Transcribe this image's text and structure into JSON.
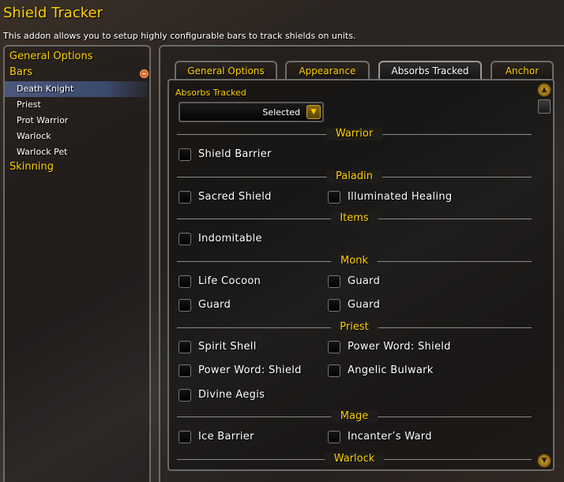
{
  "header": {
    "title": "Shield Tracker",
    "description": "This addon allows you to setup highly configurable bars to track shields on units."
  },
  "tree": {
    "general_options": "General Options",
    "bars": "Bars",
    "bar_items": [
      "Death Knight",
      "Priest",
      "Prot Warrior",
      "Warlock",
      "Warlock Pet"
    ],
    "selected": "Death Knight",
    "skinning": "Skinning"
  },
  "tabs": [
    "General Options",
    "Appearance",
    "Absorbs Tracked",
    "Anchor"
  ],
  "active_tab": "Absorbs Tracked",
  "absorbs": {
    "group_label": "Absorbs Tracked",
    "dropdown_value": "Selected",
    "sections": {
      "warrior": {
        "title": "Warrior",
        "options": [
          "Shield Barrier"
        ]
      },
      "paladin": {
        "title": "Paladin",
        "options": [
          "Sacred Shield",
          "Illuminated Healing"
        ]
      },
      "items": {
        "title": "Items",
        "options": [
          "Indomitable"
        ]
      },
      "monk": {
        "title": "Monk",
        "options": [
          "Life Cocoon",
          "Guard",
          "Guard",
          "Guard"
        ]
      },
      "priest": {
        "title": "Priest",
        "options": [
          "Spirit Shell",
          "Power Word: Shield",
          "Power Word: Shield",
          "Angelic Bulwark",
          "Divine Aegis"
        ]
      },
      "mage": {
        "title": "Mage",
        "options": [
          "Ice Barrier",
          "Incanter’s Ward"
        ]
      },
      "warlock": {
        "title": "Warlock"
      }
    }
  },
  "icons": {
    "collapse": "minus-icon",
    "dropdown": "chevron-down-icon",
    "scroll_up": "arrow-up-icon",
    "scroll_down": "arrow-down-icon"
  },
  "colors": {
    "gold": "#ffd100",
    "selected_row": "#3b4a6d"
  }
}
